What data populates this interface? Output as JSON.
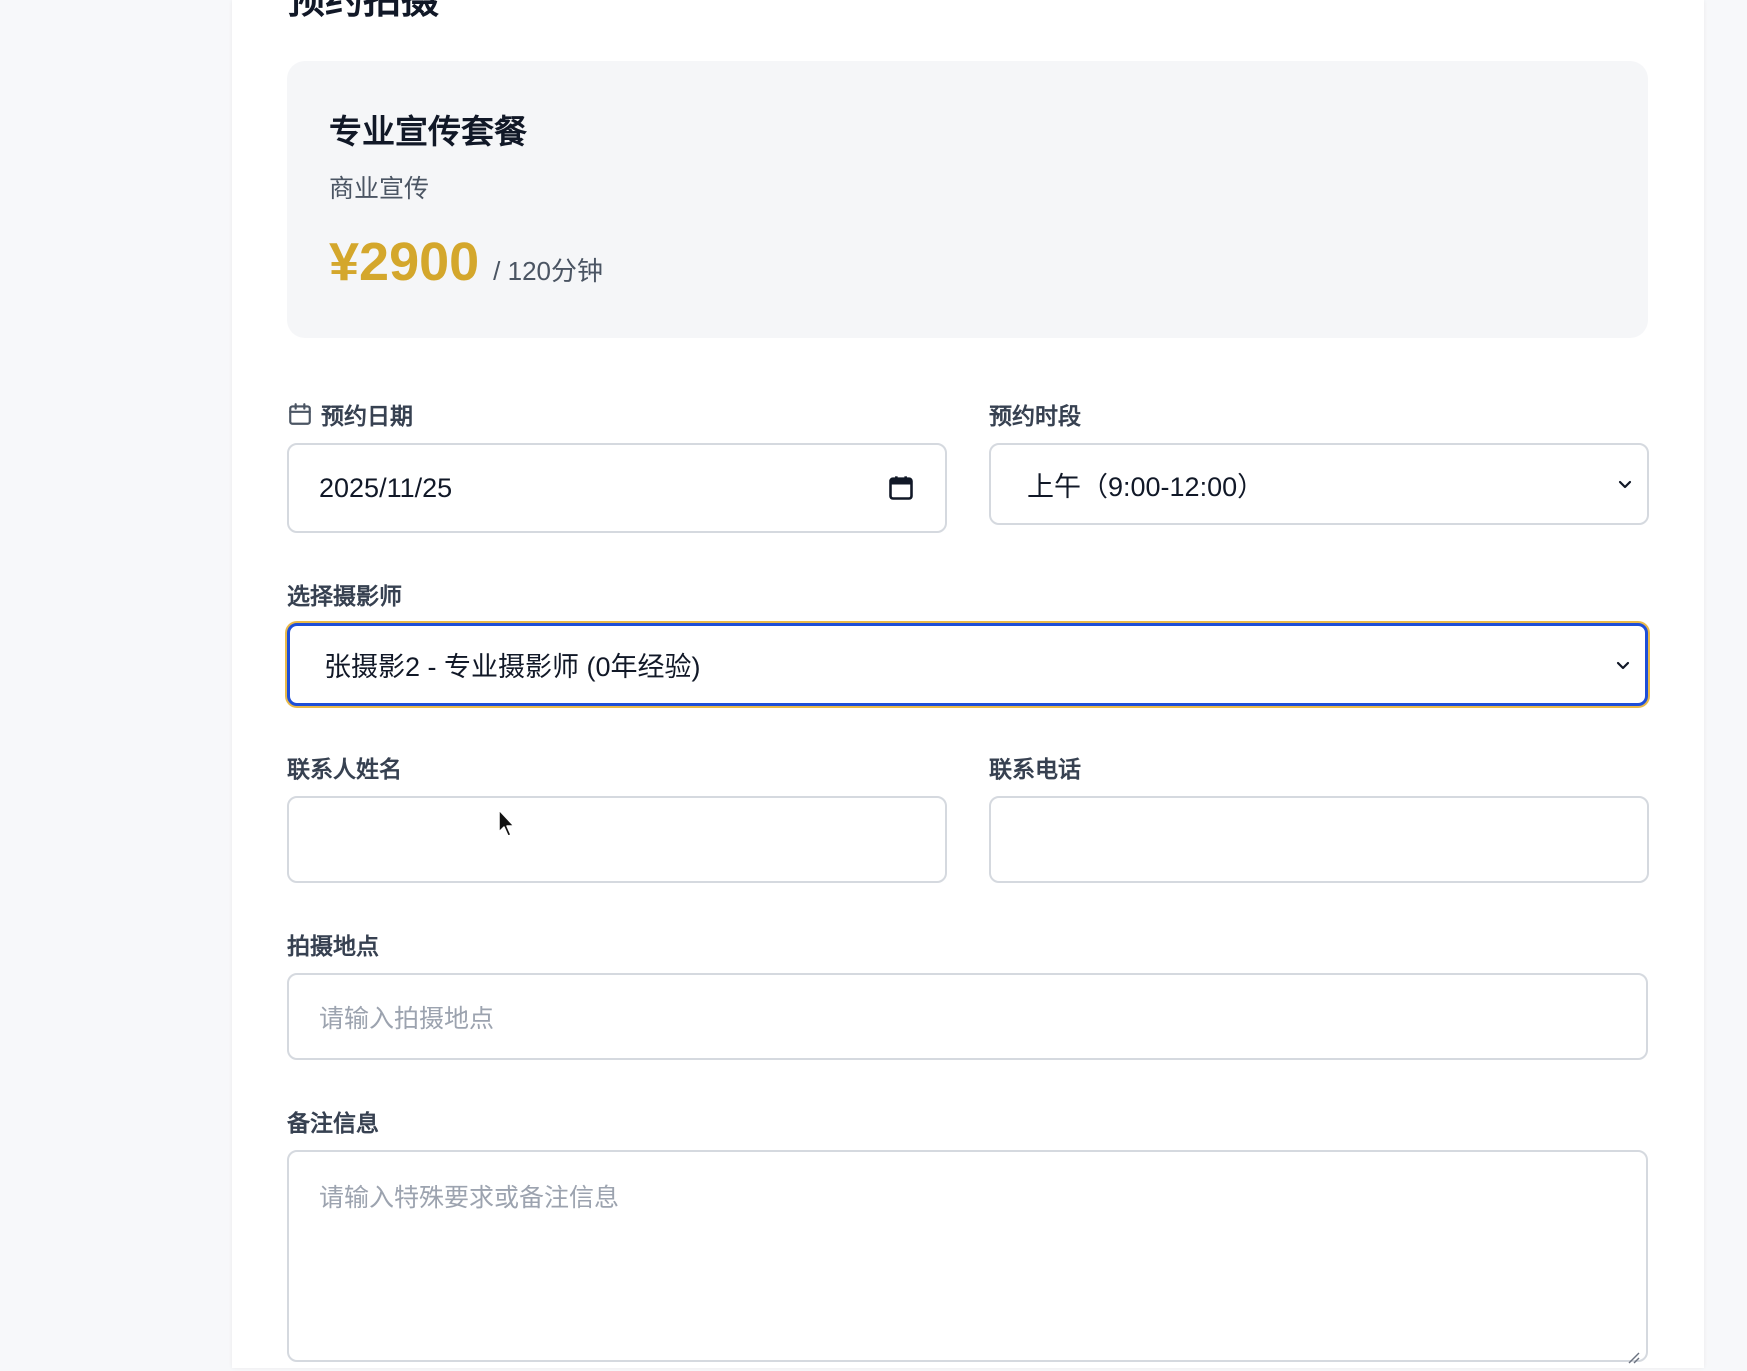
{
  "page": {
    "title": "预约拍摄"
  },
  "package": {
    "name": "专业宣传套餐",
    "category": "商业宣传",
    "price": "¥2900",
    "duration": "/ 120分钟",
    "price_color": "#d4a72c"
  },
  "form": {
    "date": {
      "label": "预约日期",
      "icon": "calendar-icon",
      "value": "2025/11/25"
    },
    "time_slot": {
      "label": "预约时段",
      "value": "上午（9:00-12:00）"
    },
    "photographer": {
      "label": "选择摄影师",
      "value": "张摄影2 - 专业摄影师 (0年经验)"
    },
    "contact_name": {
      "label": "联系人姓名",
      "value": ""
    },
    "contact_phone": {
      "label": "联系电话",
      "value": ""
    },
    "location": {
      "label": "拍摄地点",
      "placeholder": "请输入拍摄地点"
    },
    "notes": {
      "label": "备注信息",
      "placeholder": "请输入特殊要求或备注信息"
    }
  },
  "colors": {
    "focus_border": "#1d4ed8",
    "focus_ring": "#e9b949"
  }
}
